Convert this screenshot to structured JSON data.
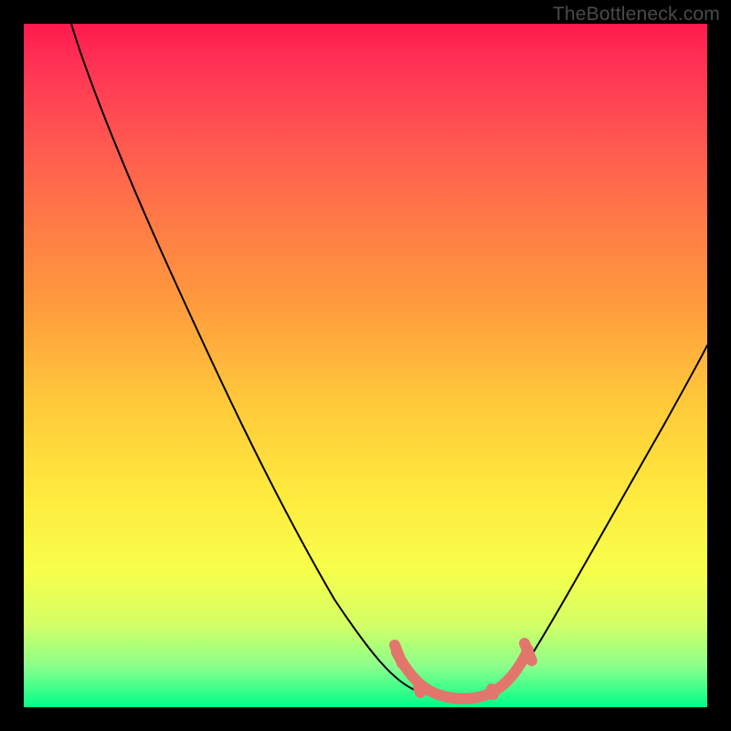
{
  "watermark": "TheBottleneck.com",
  "chart_data": {
    "type": "line",
    "title": "",
    "xlabel": "",
    "ylabel": "",
    "xlim": [
      0,
      100
    ],
    "ylim": [
      0,
      100
    ],
    "series": [
      {
        "name": "bottleneck-curve",
        "x": [
          7,
          13,
          20,
          27,
          34,
          41,
          48,
          55,
          58,
          60,
          63,
          66,
          69,
          72,
          75,
          80,
          86,
          92,
          100
        ],
        "y": [
          100,
          88,
          75,
          62,
          49,
          36,
          23,
          9,
          4,
          2,
          1,
          1,
          1.5,
          3,
          6,
          14,
          27,
          40,
          55
        ]
      }
    ],
    "highlight_region": {
      "name": "optimal-range",
      "x": [
        55,
        58,
        61,
        64,
        67,
        70,
        72,
        73
      ],
      "y": [
        8,
        4,
        2,
        1.5,
        1.5,
        3,
        5,
        7
      ]
    },
    "colors": {
      "curve": "#000000",
      "highlight": "#e2766c",
      "gradient_top": "#ff1a4d",
      "gradient_bottom": "#00ff8a"
    }
  }
}
